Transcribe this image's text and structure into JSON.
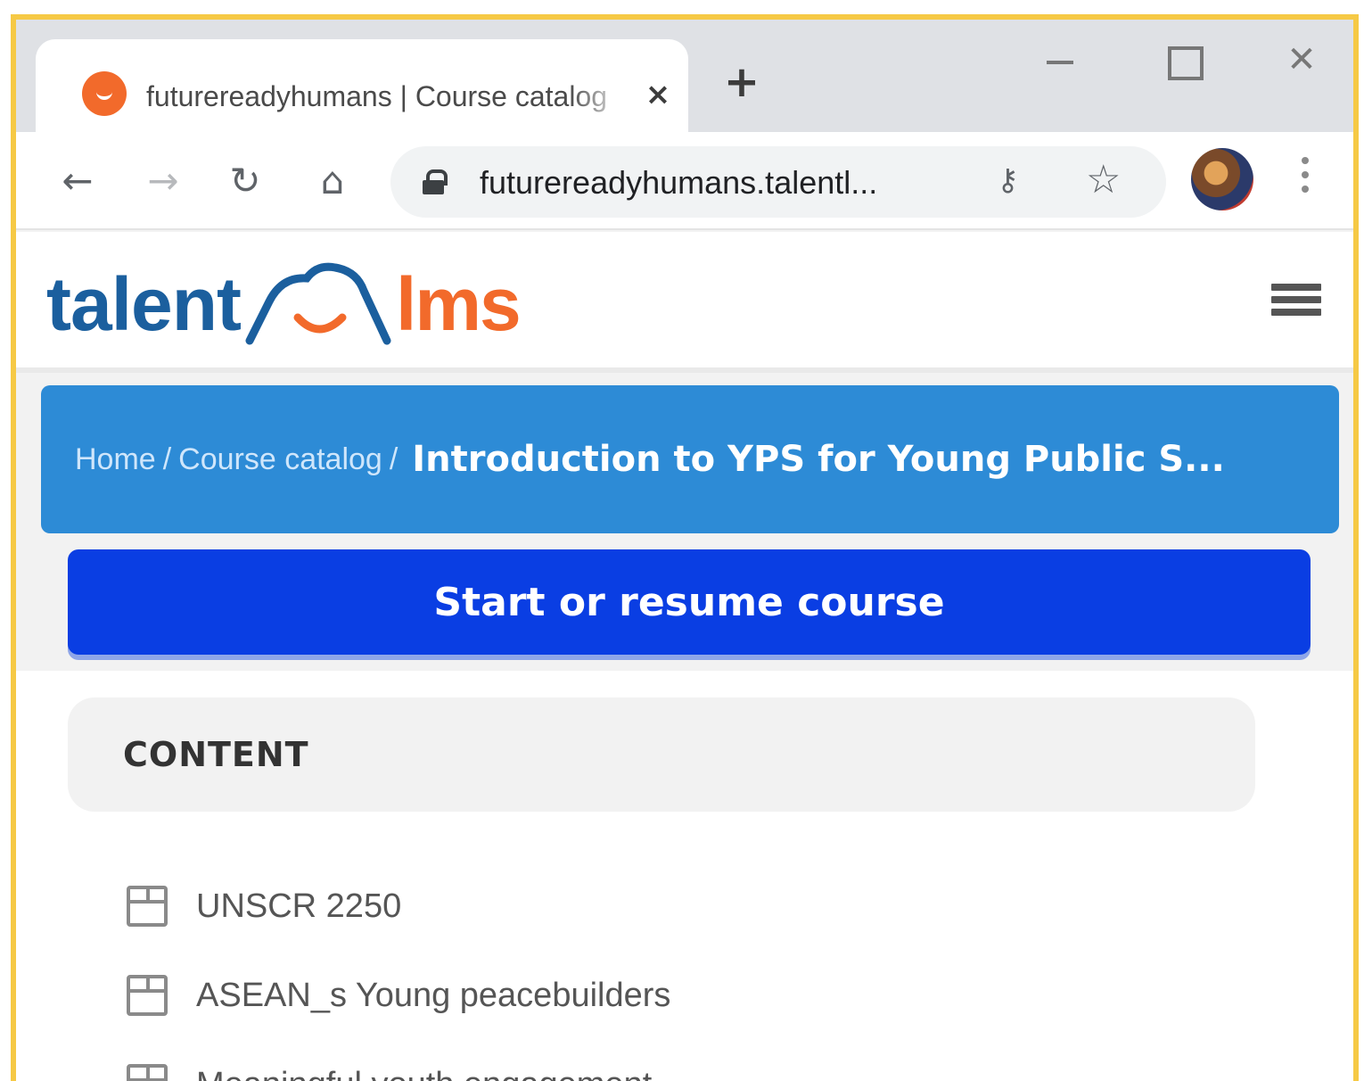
{
  "browser": {
    "tab_title": "futurereadyhumans | Course catalog",
    "new_tab_label": "+",
    "url": "futurereadyhumans.talentl...",
    "window_controls": [
      "minimize",
      "maximize",
      "close"
    ]
  },
  "site": {
    "logo_left": "talent",
    "logo_right": "lms"
  },
  "breadcrumb": {
    "items": [
      "Home",
      "Course catalog"
    ],
    "separator": "/",
    "current": "Introduction to YPS for Young Public S..."
  },
  "course": {
    "start_button_label": "Start or resume course"
  },
  "content": {
    "title": "CONTENT",
    "units": [
      {
        "label": "UNSCR 2250"
      },
      {
        "label": "ASEAN_s Young peacebuilders"
      },
      {
        "label": "Meaningful youth engagement"
      }
    ]
  },
  "colors": {
    "accent_border": "#f6c945",
    "breadcrumb_bg": "#2d8bd6",
    "button_bg": "#0a3ee3",
    "logo_blue": "#1b5f9e",
    "logo_orange": "#f26a2b"
  }
}
